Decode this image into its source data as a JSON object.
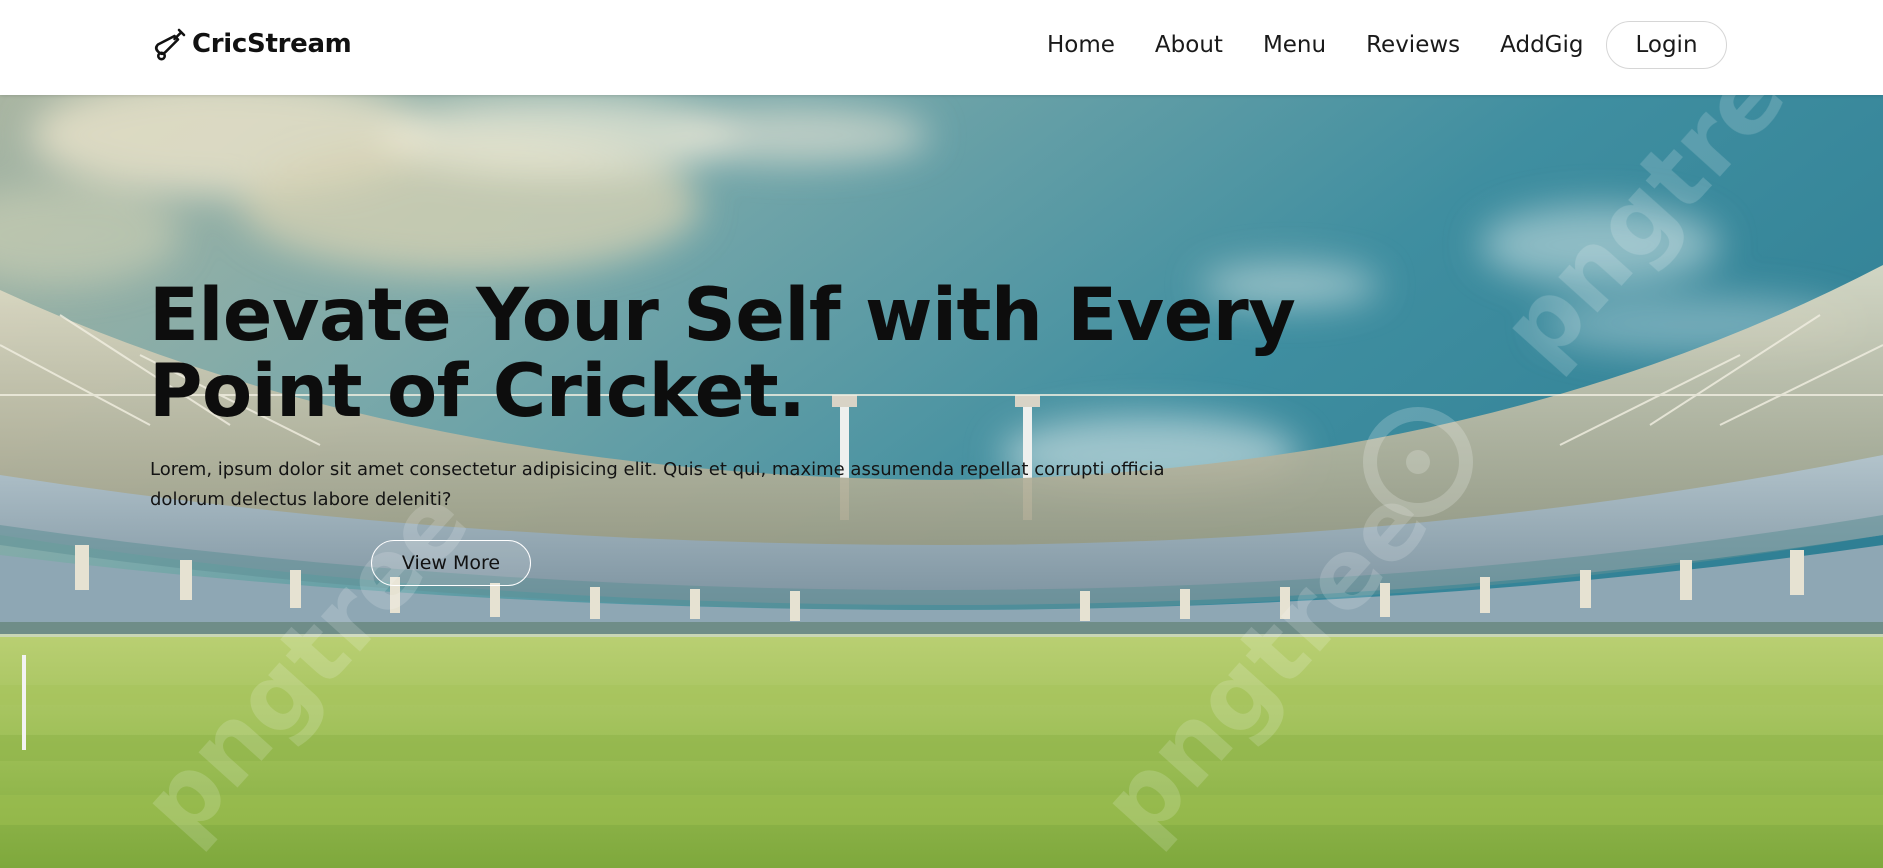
{
  "brand": {
    "name": "CricStream",
    "icon": "cricket-bat-ball-icon"
  },
  "nav": {
    "items": [
      {
        "label": "Home"
      },
      {
        "label": "About"
      },
      {
        "label": "Menu"
      },
      {
        "label": "Reviews"
      },
      {
        "label": "AddGig"
      }
    ],
    "login_label": "Login"
  },
  "hero": {
    "title": "Elevate Your Self with Every Point of Cricket.",
    "description": "Lorem, ipsum dolor sit amet consectetur adipisicing elit. Quis et qui, maxime assumenda repellat corrupti officia dolorum delectus labore deleniti?",
    "button_label": "View More",
    "watermark_text": "pngtree",
    "background": "cricket-stadium-image"
  },
  "colors": {
    "text": "#0d0d0d",
    "nav_bg": "#ffffff",
    "sky": "#3f8ea0",
    "grass": "#8fb848",
    "button_border": "#d6d6d6"
  }
}
